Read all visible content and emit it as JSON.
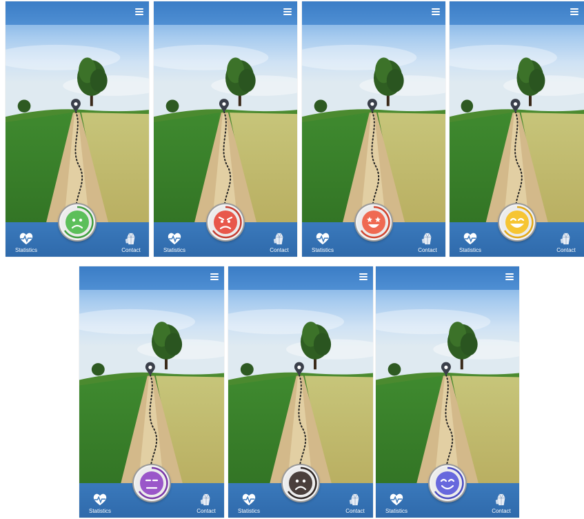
{
  "screens": [
    {
      "mood_icon": "sad-face-icon",
      "mood_color": "#5cbf5a",
      "ring_color": "#3f9e3d"
    },
    {
      "mood_icon": "angry-face-icon",
      "mood_color": "#e8574b",
      "ring_color": "#c53c30"
    },
    {
      "mood_icon": "star-eyes-face-icon",
      "mood_color": "#ef6a52",
      "ring_color": "#d2442e"
    },
    {
      "mood_icon": "grinning-face-icon",
      "mood_color": "#f6c533",
      "ring_color": "#e2a814"
    },
    {
      "mood_icon": "neutral-face-icon",
      "mood_color": "#9a56c9",
      "ring_color": "#7a36a8"
    },
    {
      "mood_icon": "frowning-face-icon",
      "mood_color": "#4a3f3c",
      "ring_color": "#2e2624"
    },
    {
      "mood_icon": "smiling-face-icon",
      "mood_color": "#6768dd",
      "ring_color": "#4a4bc1"
    }
  ],
  "labels": {
    "statistics": "Statistics",
    "contact": "Contact"
  }
}
